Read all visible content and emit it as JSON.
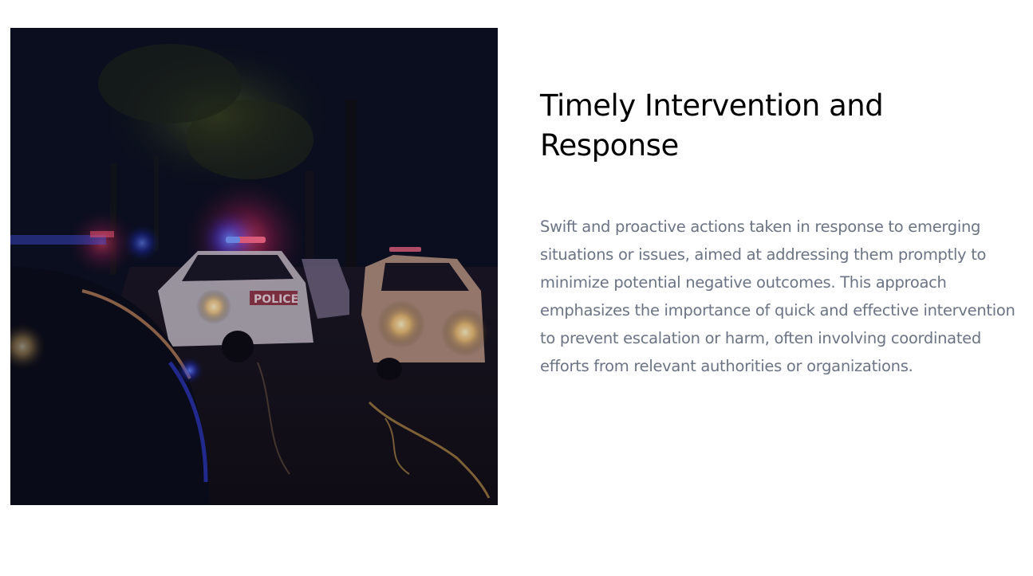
{
  "slide": {
    "title": "Timely Intervention and Response",
    "body": "Swift and proactive actions taken in response to emerging situations or issues, aimed at addressing them promptly to minimize potential negative outcomes. This approach emphasizes the importance of quick and effective intervention to prevent escalation or harm, often involving coordinated efforts from relevant authorities or organizations."
  },
  "image": {
    "subject": "police-cars-at-night-photo",
    "car_marking": "POLICE"
  },
  "colors": {
    "title": "#000000",
    "body": "#6b7385",
    "photo_base": "#0a0f1e",
    "siren_red": "#ff2a4a",
    "siren_blue": "#2a5bff",
    "headlight": "#ffd58a"
  }
}
